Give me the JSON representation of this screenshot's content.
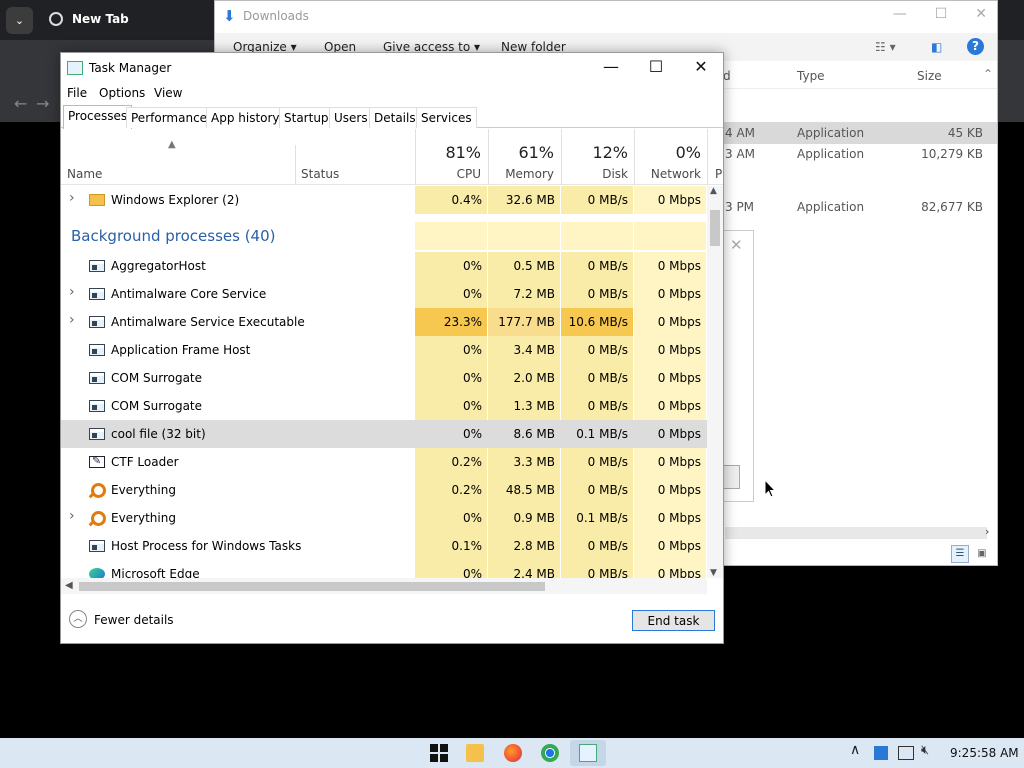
{
  "browser": {
    "tab_title": "New Tab",
    "menu_icon": "chevron-down-icon",
    "back_glyph": "←",
    "forward_glyph": "→"
  },
  "explorer": {
    "title": "Downloads",
    "commands": [
      "Organize ▾",
      "Open",
      "Give access to ▾",
      "New folder"
    ],
    "columns": {
      "type": "Type",
      "size": "Size",
      "partial": "d"
    },
    "rows": [
      {
        "time": "4 AM",
        "type": "Application",
        "size": "45 KB"
      },
      {
        "time": "3 AM",
        "type": "Application",
        "size": "10,279 KB"
      },
      {
        "time": "3 PM",
        "type": "Application",
        "size": "82,677 KB"
      }
    ]
  },
  "taskmgr": {
    "title": "Task Manager",
    "menu": [
      "File",
      "Options",
      "View"
    ],
    "tabs": [
      "Processes",
      "Performance",
      "App history",
      "Startup",
      "Users",
      "Details",
      "Services"
    ],
    "active_tab": "Processes",
    "header": {
      "name": "Name",
      "status": "Status",
      "cpu_pct": "81%",
      "cpu": "CPU",
      "memory_pct": "61%",
      "memory": "Memory",
      "disk_pct": "12%",
      "disk": "Disk",
      "network_pct": "0%",
      "network": "Network",
      "power_partial": "P"
    },
    "group_title": "Background processes (40)",
    "rows": [
      {
        "name": "Windows Explorer (2)",
        "expand": true,
        "icon": "folder",
        "cpu": "0.4%",
        "memory": "32.6 MB",
        "disk": "0 MB/s",
        "network": "0 Mbps"
      },
      {
        "group": true
      },
      {
        "name": "AggregatorHost",
        "expand": false,
        "icon": "app",
        "cpu": "0%",
        "memory": "0.5 MB",
        "disk": "0 MB/s",
        "network": "0 Mbps"
      },
      {
        "name": "Antimalware Core Service",
        "expand": true,
        "icon": "app",
        "cpu": "0%",
        "memory": "7.2 MB",
        "disk": "0 MB/s",
        "network": "0 Mbps"
      },
      {
        "name": "Antimalware Service Executable",
        "expand": true,
        "icon": "app",
        "cpu": "23.3%",
        "memory": "177.7 MB",
        "disk": "10.6 MB/s",
        "network": "0 Mbps",
        "hot": true
      },
      {
        "name": "Application Frame Host",
        "expand": false,
        "icon": "app",
        "cpu": "0%",
        "memory": "3.4 MB",
        "disk": "0 MB/s",
        "network": "0 Mbps"
      },
      {
        "name": "COM Surrogate",
        "expand": false,
        "icon": "app",
        "cpu": "0%",
        "memory": "2.0 MB",
        "disk": "0 MB/s",
        "network": "0 Mbps"
      },
      {
        "name": "COM Surrogate",
        "expand": false,
        "icon": "app",
        "cpu": "0%",
        "memory": "1.3 MB",
        "disk": "0 MB/s",
        "network": "0 Mbps"
      },
      {
        "name": "cool file (32 bit)",
        "expand": false,
        "icon": "app",
        "cpu": "0%",
        "memory": "8.6 MB",
        "disk": "0.1 MB/s",
        "network": "0 Mbps",
        "selected": true
      },
      {
        "name": "CTF Loader",
        "expand": false,
        "icon": "ctf",
        "cpu": "0.2%",
        "memory": "3.3 MB",
        "disk": "0 MB/s",
        "network": "0 Mbps"
      },
      {
        "name": "Everything",
        "expand": false,
        "icon": "search",
        "cpu": "0.2%",
        "memory": "48.5 MB",
        "disk": "0 MB/s",
        "network": "0 Mbps"
      },
      {
        "name": "Everything",
        "expand": true,
        "icon": "search",
        "cpu": "0%",
        "memory": "0.9 MB",
        "disk": "0.1 MB/s",
        "network": "0 Mbps"
      },
      {
        "name": "Host Process for Windows Tasks",
        "expand": false,
        "icon": "app",
        "cpu": "0.1%",
        "memory": "2.8 MB",
        "disk": "0 MB/s",
        "network": "0 Mbps"
      },
      {
        "name": "Microsoft Edge",
        "expand": false,
        "icon": "edge",
        "cpu": "0%",
        "memory": "2.4 MB",
        "disk": "0 MB/s",
        "network": "0 Mbps"
      }
    ],
    "fewer_details": "Fewer details",
    "end_task": "End task"
  },
  "colors": {
    "heat_low": "#fff4c4",
    "heat_mid": "#f9eca8",
    "heat_hot": "#f7c84f",
    "group_title": "#2a5fa8",
    "accent": "#2b79d6"
  },
  "taskbar": {
    "clock": "9:25:58 AM",
    "chevron": "∧"
  }
}
